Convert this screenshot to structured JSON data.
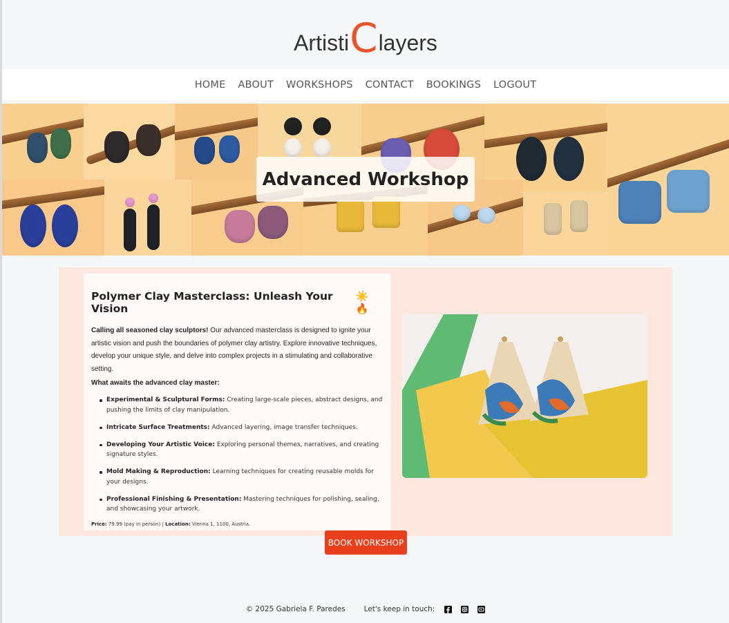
{
  "brand": {
    "logo_part1": "Artisti",
    "logo_c": "C",
    "logo_part2": "layers",
    "accent_color": "#e8532a"
  },
  "nav": {
    "items": [
      "HOME",
      "ABOUT",
      "WORKSHOPS",
      "CONTACT",
      "BOOKINGS",
      "LOGOUT"
    ]
  },
  "hero": {
    "title": "Advanced Workshop"
  },
  "workshop": {
    "title": "Polymer Clay Masterclass: Unleash Your Vision",
    "title_emojis": "☀️ 🔥",
    "intro_bold": "Calling all seasoned clay sculptors!",
    "intro_text": " Our advanced masterclass is designed to ignite your artistic vision and push the boundaries of polymer clay artistry. Explore innovative techniques, develop your unique style, and delve into complex projects in a stimulating and collaborative setting.",
    "awaits_heading": "What awaits the advanced clay master:",
    "features": [
      {
        "label": "Experimental & Sculptural Forms:",
        "text": " Creating large-scale pieces, abstract designs, and pushing the limits of clay manipulation."
      },
      {
        "label": "Intricate Surface Treatments:",
        "text": " Advanced layering, image transfer techniques."
      },
      {
        "label": "Developing Your Artistic Voice:",
        "text": " Exploring personal themes, narratives, and creating signature styles."
      },
      {
        "label": "Mold Making & Reproduction:",
        "text": " Learning techniques for creating reusable molds for your designs."
      },
      {
        "label": "Professional Finishing & Presentation:",
        "text": " Mastering techniques for polishing, sealing, and showcasing your artwork."
      }
    ],
    "price_label": "Price:",
    "price_value": " 79.99 (pay in person) | ",
    "location_label": "Location:",
    "location_value": " Vienna 1, 1100, Austria."
  },
  "cta": {
    "book_label": "BOOK WORKSHOP",
    "button_color": "#e8401c"
  },
  "footer": {
    "copyright": "© 2025 Gabriela F. Paredes",
    "touch_label": "Let's keep in touch:",
    "social_icons": [
      "facebook-icon",
      "instagram-icon",
      "youtube-icon"
    ]
  }
}
